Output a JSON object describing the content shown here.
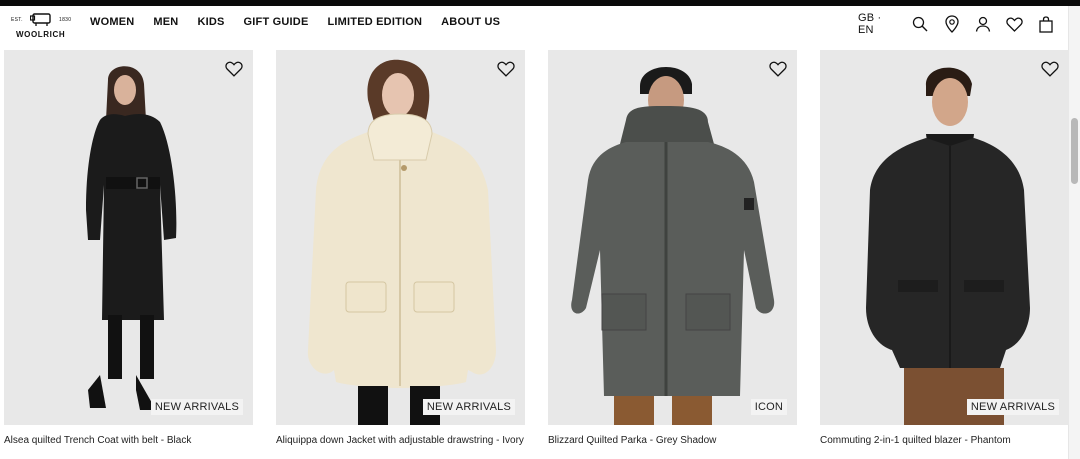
{
  "brand": {
    "est": "EST.",
    "year": "1830",
    "name": "WOOLRICH"
  },
  "nav": [
    "WOMEN",
    "MEN",
    "KIDS",
    "GIFT GUIDE",
    "LIMITED EDITION",
    "ABOUT US"
  ],
  "locale": "GB · EN",
  "icons": [
    "search-icon",
    "store-locator-icon",
    "account-icon",
    "wishlist-icon",
    "bag-icon"
  ],
  "products": [
    {
      "name": "Alsea quilted Trench Coat with belt - Black",
      "badge": "NEW ARRIVALS",
      "color": "#1b1b1b"
    },
    {
      "name": "Aliquippa down Jacket with adjustable drawstring - Ivory",
      "badge": "NEW ARRIVALS",
      "color": "#efe6cf"
    },
    {
      "name": "Blizzard Quilted Parka - Grey Shadow",
      "badge": "ICON",
      "color": "#5a5d5a"
    },
    {
      "name": "Commuting 2-in-1 quilted blazer - Phantom",
      "badge": "NEW ARRIVALS",
      "color": "#262626"
    }
  ]
}
